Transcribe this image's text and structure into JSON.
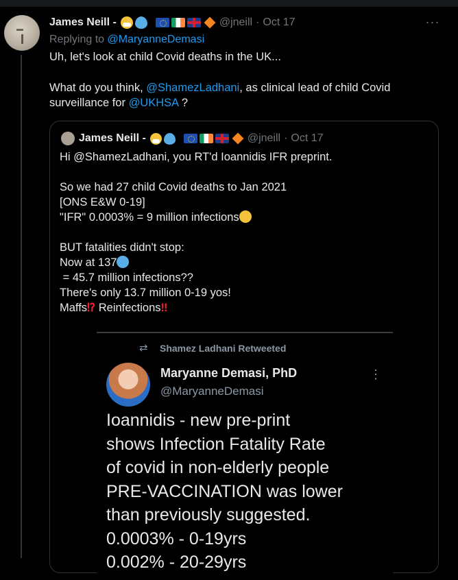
{
  "tweet": {
    "display_name": "James Neill -",
    "handle": "@jneill",
    "separator": "·",
    "date": "Oct 17",
    "replying_prefix": "Replying to",
    "replying_to": "@MaryanneDemasi",
    "text_line1": "Uh, let's look at child Covid deaths in the UK...",
    "text_p2_a": "What do you think, ",
    "mention_1": "@ShamezLadhani",
    "text_p2_b": ", as clinical lead of child Covid surveillance for ",
    "mention_2": "@UKHSA",
    "text_p2_c": " ?",
    "more_label": "···"
  },
  "quote": {
    "display_name": "James Neill -",
    "handle": "@jneill",
    "separator": "·",
    "date": "Oct 17",
    "line1": "Hi @ShamezLadhani, you RT'd Ioannidis IFR preprint.",
    "line2": "So we had 27 child Covid deaths to Jan 2021",
    "line3": "[ONS E&W 0-19]",
    "line4": "\"IFR\" 0.0003% = 9 million infections",
    "line5": "BUT fatalities didn't stop:",
    "line6": "Now at 137",
    "line7": " = 45.7 million infections??",
    "line8": "There's only 13.7 million 0-19 yos!",
    "line9_a": "Maffs",
    "line9_mark": "⁉",
    "line9_b": " Reinfections",
    "line9_mark2": "‼"
  },
  "embedded_screenshot": {
    "retweet_label": "Shamez Ladhani Retweeted",
    "retweet_icon": "⇄",
    "name": "Maryanne Demasi, PhD",
    "handle": "@MaryanneDemasi",
    "more_label": "⋮",
    "body": "Ioannidis - new pre-print\nshows Infection Fatality Rate\nof covid in non-elderly people\nPRE-VACCINATION was lower\nthan previously suggested.\n0.0003% - 0-19yrs\n0.002% - 20-29yrs"
  },
  "colors": {
    "background": "#000000",
    "text": "#e7e9ea",
    "muted": "#71767b",
    "link": "#1d9bf0",
    "border": "#2f3336"
  }
}
